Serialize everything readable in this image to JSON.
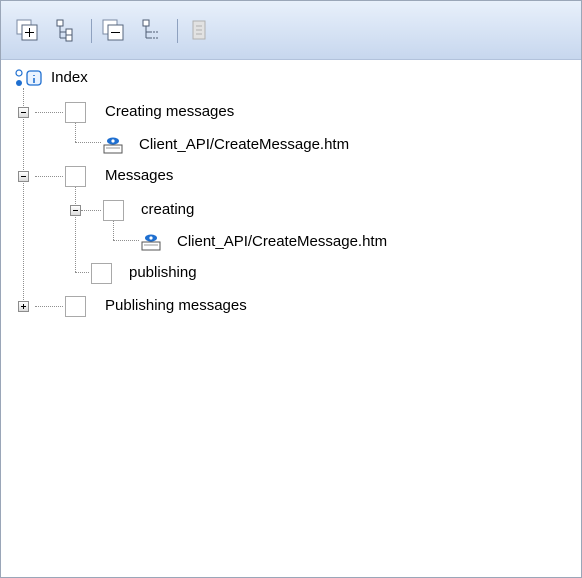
{
  "toolbar": {
    "buttons": [
      {
        "icon": "expand-all-icon"
      },
      {
        "icon": "show-hierarchy-icon"
      },
      {
        "icon": "collapse-all-icon"
      },
      {
        "icon": "hide-hierarchy-icon"
      },
      {
        "icon": "properties-icon",
        "disabled": true
      }
    ]
  },
  "tree": {
    "root": {
      "label": "Index",
      "icon": "index-icon"
    },
    "items": [
      {
        "label": "Creating messages",
        "state": "expanded",
        "children": [
          {
            "label": "Client_API/CreateMessage.htm",
            "icon": "topic-page-icon"
          }
        ]
      },
      {
        "label": "Messages",
        "state": "expanded",
        "children": [
          {
            "label": "creating",
            "state": "expanded",
            "children": [
              {
                "label": "Client_API/CreateMessage.htm",
                "icon": "topic-page-icon"
              }
            ]
          },
          {
            "label": "publishing"
          }
        ]
      },
      {
        "label": "Publishing messages",
        "state": "collapsed"
      }
    ]
  },
  "colors": {
    "toolbar_top": "#e8f0fb",
    "toolbar_bottom": "#c7d7ee",
    "border": "#9aa6b8"
  }
}
